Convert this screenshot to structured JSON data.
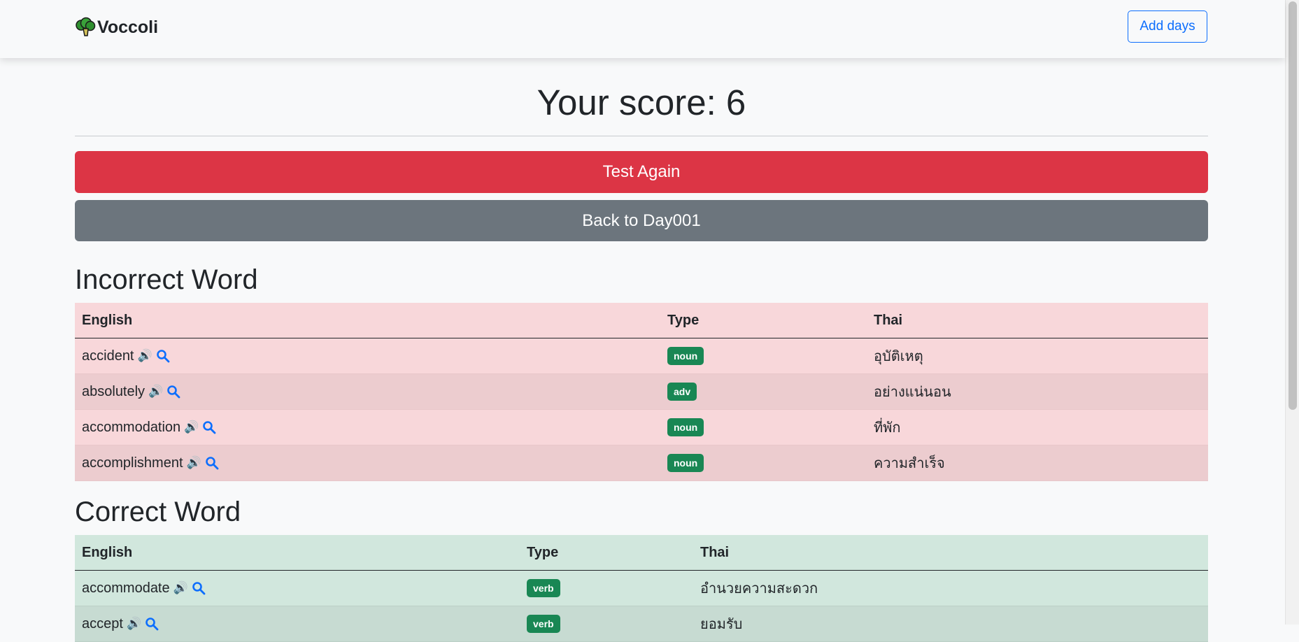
{
  "navbar": {
    "brand": "Voccoli",
    "add_days_label": "Add days"
  },
  "result": {
    "score_text": "Your score: 6",
    "test_again_label": "Test Again",
    "back_label": "Back to Day001"
  },
  "incorrect": {
    "title": "Incorrect Word",
    "headers": {
      "english": "English",
      "type": "Type",
      "thai": "Thai"
    },
    "rows": [
      {
        "english": "accident",
        "type": "noun",
        "thai": "อุบัติเหตุ"
      },
      {
        "english": "absolutely",
        "type": "adv",
        "thai": "อย่างแน่นอน"
      },
      {
        "english": "accommodation",
        "type": "noun",
        "thai": "ที่พัก"
      },
      {
        "english": "accomplishment",
        "type": "noun",
        "thai": "ความสำเร็จ"
      }
    ]
  },
  "correct": {
    "title": "Correct Word",
    "headers": {
      "english": "English",
      "type": "Type",
      "thai": "Thai"
    },
    "rows": [
      {
        "english": "accommodate",
        "type": "verb",
        "thai": "อำนวยความสะดวก"
      },
      {
        "english": "accept",
        "type": "verb",
        "thai": "ยอมรับ"
      }
    ]
  },
  "icons": {
    "speaker": "speaker-icon",
    "search": "search-icon",
    "logo": "broccoli-logo"
  },
  "colors": {
    "danger": "#dc3545",
    "secondary": "#6c757d",
    "primary": "#0d6efd",
    "success": "#198754",
    "incorrect_bg": "#f8d7da",
    "correct_bg": "#d1e7dd"
  }
}
